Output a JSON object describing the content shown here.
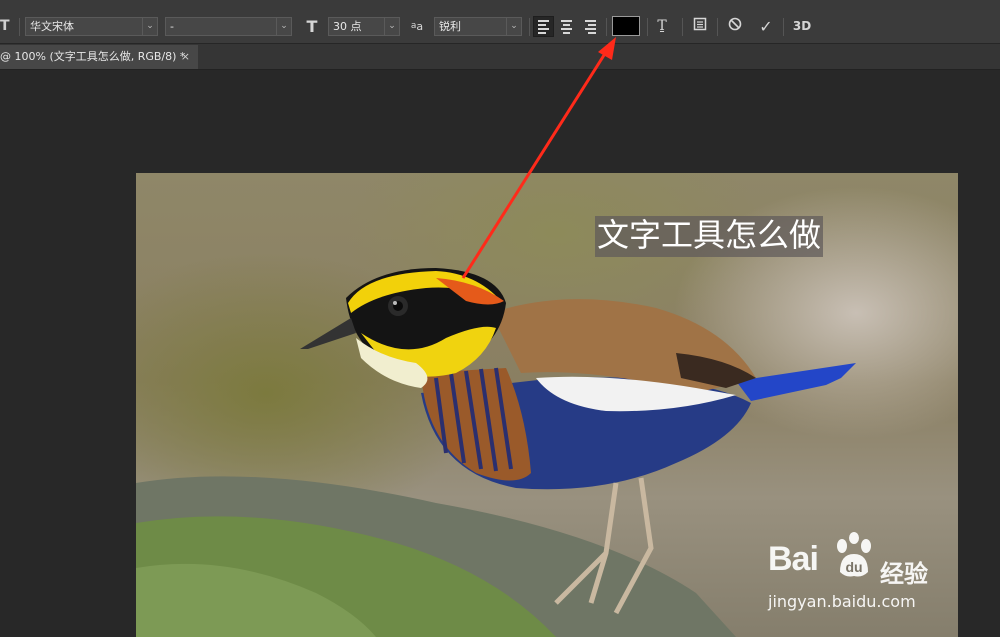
{
  "options_bar": {
    "tool_glyph": "T",
    "font_family": "华文宋体",
    "font_style": "-",
    "size_glyph": "T",
    "font_size": "30 点",
    "aa_glyph": "a",
    "antialias": "锐利",
    "text_color": "#000000",
    "threed_label": "3D"
  },
  "tab": {
    "title": "@ 100% (文字工具怎么做, RGB/8) *",
    "close": "×"
  },
  "canvas": {
    "text_layer": "文字工具怎么做"
  },
  "watermark": {
    "brand": "Bai",
    "brand_cn": "经验",
    "url": "jingyan.baidu.com"
  },
  "annotation_color": "#ff2a1a"
}
